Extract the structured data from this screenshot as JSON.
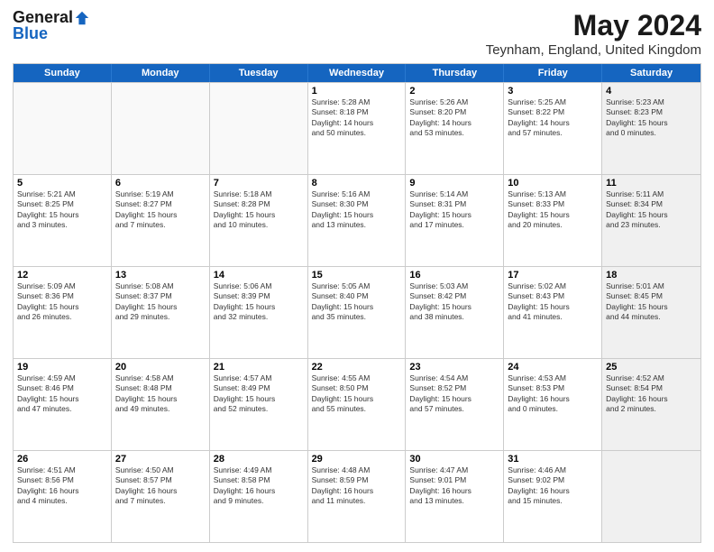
{
  "header": {
    "logo_line1": "General",
    "logo_line2": "Blue",
    "title": "May 2024",
    "subtitle": "Teynham, England, United Kingdom"
  },
  "days_of_week": [
    "Sunday",
    "Monday",
    "Tuesday",
    "Wednesday",
    "Thursday",
    "Friday",
    "Saturday"
  ],
  "weeks": [
    {
      "cells": [
        {
          "day": "",
          "empty": true
        },
        {
          "day": "",
          "empty": true
        },
        {
          "day": "",
          "empty": true
        },
        {
          "day": "1",
          "lines": [
            "Sunrise: 5:28 AM",
            "Sunset: 8:18 PM",
            "Daylight: 14 hours",
            "and 50 minutes."
          ]
        },
        {
          "day": "2",
          "lines": [
            "Sunrise: 5:26 AM",
            "Sunset: 8:20 PM",
            "Daylight: 14 hours",
            "and 53 minutes."
          ]
        },
        {
          "day": "3",
          "lines": [
            "Sunrise: 5:25 AM",
            "Sunset: 8:22 PM",
            "Daylight: 14 hours",
            "and 57 minutes."
          ]
        },
        {
          "day": "4",
          "lines": [
            "Sunrise: 5:23 AM",
            "Sunset: 8:23 PM",
            "Daylight: 15 hours",
            "and 0 minutes."
          ],
          "shaded": true
        }
      ]
    },
    {
      "cells": [
        {
          "day": "5",
          "lines": [
            "Sunrise: 5:21 AM",
            "Sunset: 8:25 PM",
            "Daylight: 15 hours",
            "and 3 minutes."
          ]
        },
        {
          "day": "6",
          "lines": [
            "Sunrise: 5:19 AM",
            "Sunset: 8:27 PM",
            "Daylight: 15 hours",
            "and 7 minutes."
          ]
        },
        {
          "day": "7",
          "lines": [
            "Sunrise: 5:18 AM",
            "Sunset: 8:28 PM",
            "Daylight: 15 hours",
            "and 10 minutes."
          ]
        },
        {
          "day": "8",
          "lines": [
            "Sunrise: 5:16 AM",
            "Sunset: 8:30 PM",
            "Daylight: 15 hours",
            "and 13 minutes."
          ]
        },
        {
          "day": "9",
          "lines": [
            "Sunrise: 5:14 AM",
            "Sunset: 8:31 PM",
            "Daylight: 15 hours",
            "and 17 minutes."
          ]
        },
        {
          "day": "10",
          "lines": [
            "Sunrise: 5:13 AM",
            "Sunset: 8:33 PM",
            "Daylight: 15 hours",
            "and 20 minutes."
          ]
        },
        {
          "day": "11",
          "lines": [
            "Sunrise: 5:11 AM",
            "Sunset: 8:34 PM",
            "Daylight: 15 hours",
            "and 23 minutes."
          ],
          "shaded": true
        }
      ]
    },
    {
      "cells": [
        {
          "day": "12",
          "lines": [
            "Sunrise: 5:09 AM",
            "Sunset: 8:36 PM",
            "Daylight: 15 hours",
            "and 26 minutes."
          ]
        },
        {
          "day": "13",
          "lines": [
            "Sunrise: 5:08 AM",
            "Sunset: 8:37 PM",
            "Daylight: 15 hours",
            "and 29 minutes."
          ]
        },
        {
          "day": "14",
          "lines": [
            "Sunrise: 5:06 AM",
            "Sunset: 8:39 PM",
            "Daylight: 15 hours",
            "and 32 minutes."
          ]
        },
        {
          "day": "15",
          "lines": [
            "Sunrise: 5:05 AM",
            "Sunset: 8:40 PM",
            "Daylight: 15 hours",
            "and 35 minutes."
          ]
        },
        {
          "day": "16",
          "lines": [
            "Sunrise: 5:03 AM",
            "Sunset: 8:42 PM",
            "Daylight: 15 hours",
            "and 38 minutes."
          ]
        },
        {
          "day": "17",
          "lines": [
            "Sunrise: 5:02 AM",
            "Sunset: 8:43 PM",
            "Daylight: 15 hours",
            "and 41 minutes."
          ]
        },
        {
          "day": "18",
          "lines": [
            "Sunrise: 5:01 AM",
            "Sunset: 8:45 PM",
            "Daylight: 15 hours",
            "and 44 minutes."
          ],
          "shaded": true
        }
      ]
    },
    {
      "cells": [
        {
          "day": "19",
          "lines": [
            "Sunrise: 4:59 AM",
            "Sunset: 8:46 PM",
            "Daylight: 15 hours",
            "and 47 minutes."
          ]
        },
        {
          "day": "20",
          "lines": [
            "Sunrise: 4:58 AM",
            "Sunset: 8:48 PM",
            "Daylight: 15 hours",
            "and 49 minutes."
          ]
        },
        {
          "day": "21",
          "lines": [
            "Sunrise: 4:57 AM",
            "Sunset: 8:49 PM",
            "Daylight: 15 hours",
            "and 52 minutes."
          ]
        },
        {
          "day": "22",
          "lines": [
            "Sunrise: 4:55 AM",
            "Sunset: 8:50 PM",
            "Daylight: 15 hours",
            "and 55 minutes."
          ]
        },
        {
          "day": "23",
          "lines": [
            "Sunrise: 4:54 AM",
            "Sunset: 8:52 PM",
            "Daylight: 15 hours",
            "and 57 minutes."
          ]
        },
        {
          "day": "24",
          "lines": [
            "Sunrise: 4:53 AM",
            "Sunset: 8:53 PM",
            "Daylight: 16 hours",
            "and 0 minutes."
          ]
        },
        {
          "day": "25",
          "lines": [
            "Sunrise: 4:52 AM",
            "Sunset: 8:54 PM",
            "Daylight: 16 hours",
            "and 2 minutes."
          ],
          "shaded": true
        }
      ]
    },
    {
      "cells": [
        {
          "day": "26",
          "lines": [
            "Sunrise: 4:51 AM",
            "Sunset: 8:56 PM",
            "Daylight: 16 hours",
            "and 4 minutes."
          ]
        },
        {
          "day": "27",
          "lines": [
            "Sunrise: 4:50 AM",
            "Sunset: 8:57 PM",
            "Daylight: 16 hours",
            "and 7 minutes."
          ]
        },
        {
          "day": "28",
          "lines": [
            "Sunrise: 4:49 AM",
            "Sunset: 8:58 PM",
            "Daylight: 16 hours",
            "and 9 minutes."
          ]
        },
        {
          "day": "29",
          "lines": [
            "Sunrise: 4:48 AM",
            "Sunset: 8:59 PM",
            "Daylight: 16 hours",
            "and 11 minutes."
          ]
        },
        {
          "day": "30",
          "lines": [
            "Sunrise: 4:47 AM",
            "Sunset: 9:01 PM",
            "Daylight: 16 hours",
            "and 13 minutes."
          ]
        },
        {
          "day": "31",
          "lines": [
            "Sunrise: 4:46 AM",
            "Sunset: 9:02 PM",
            "Daylight: 16 hours",
            "and 15 minutes."
          ]
        },
        {
          "day": "",
          "empty": true,
          "shaded": true
        }
      ]
    }
  ]
}
